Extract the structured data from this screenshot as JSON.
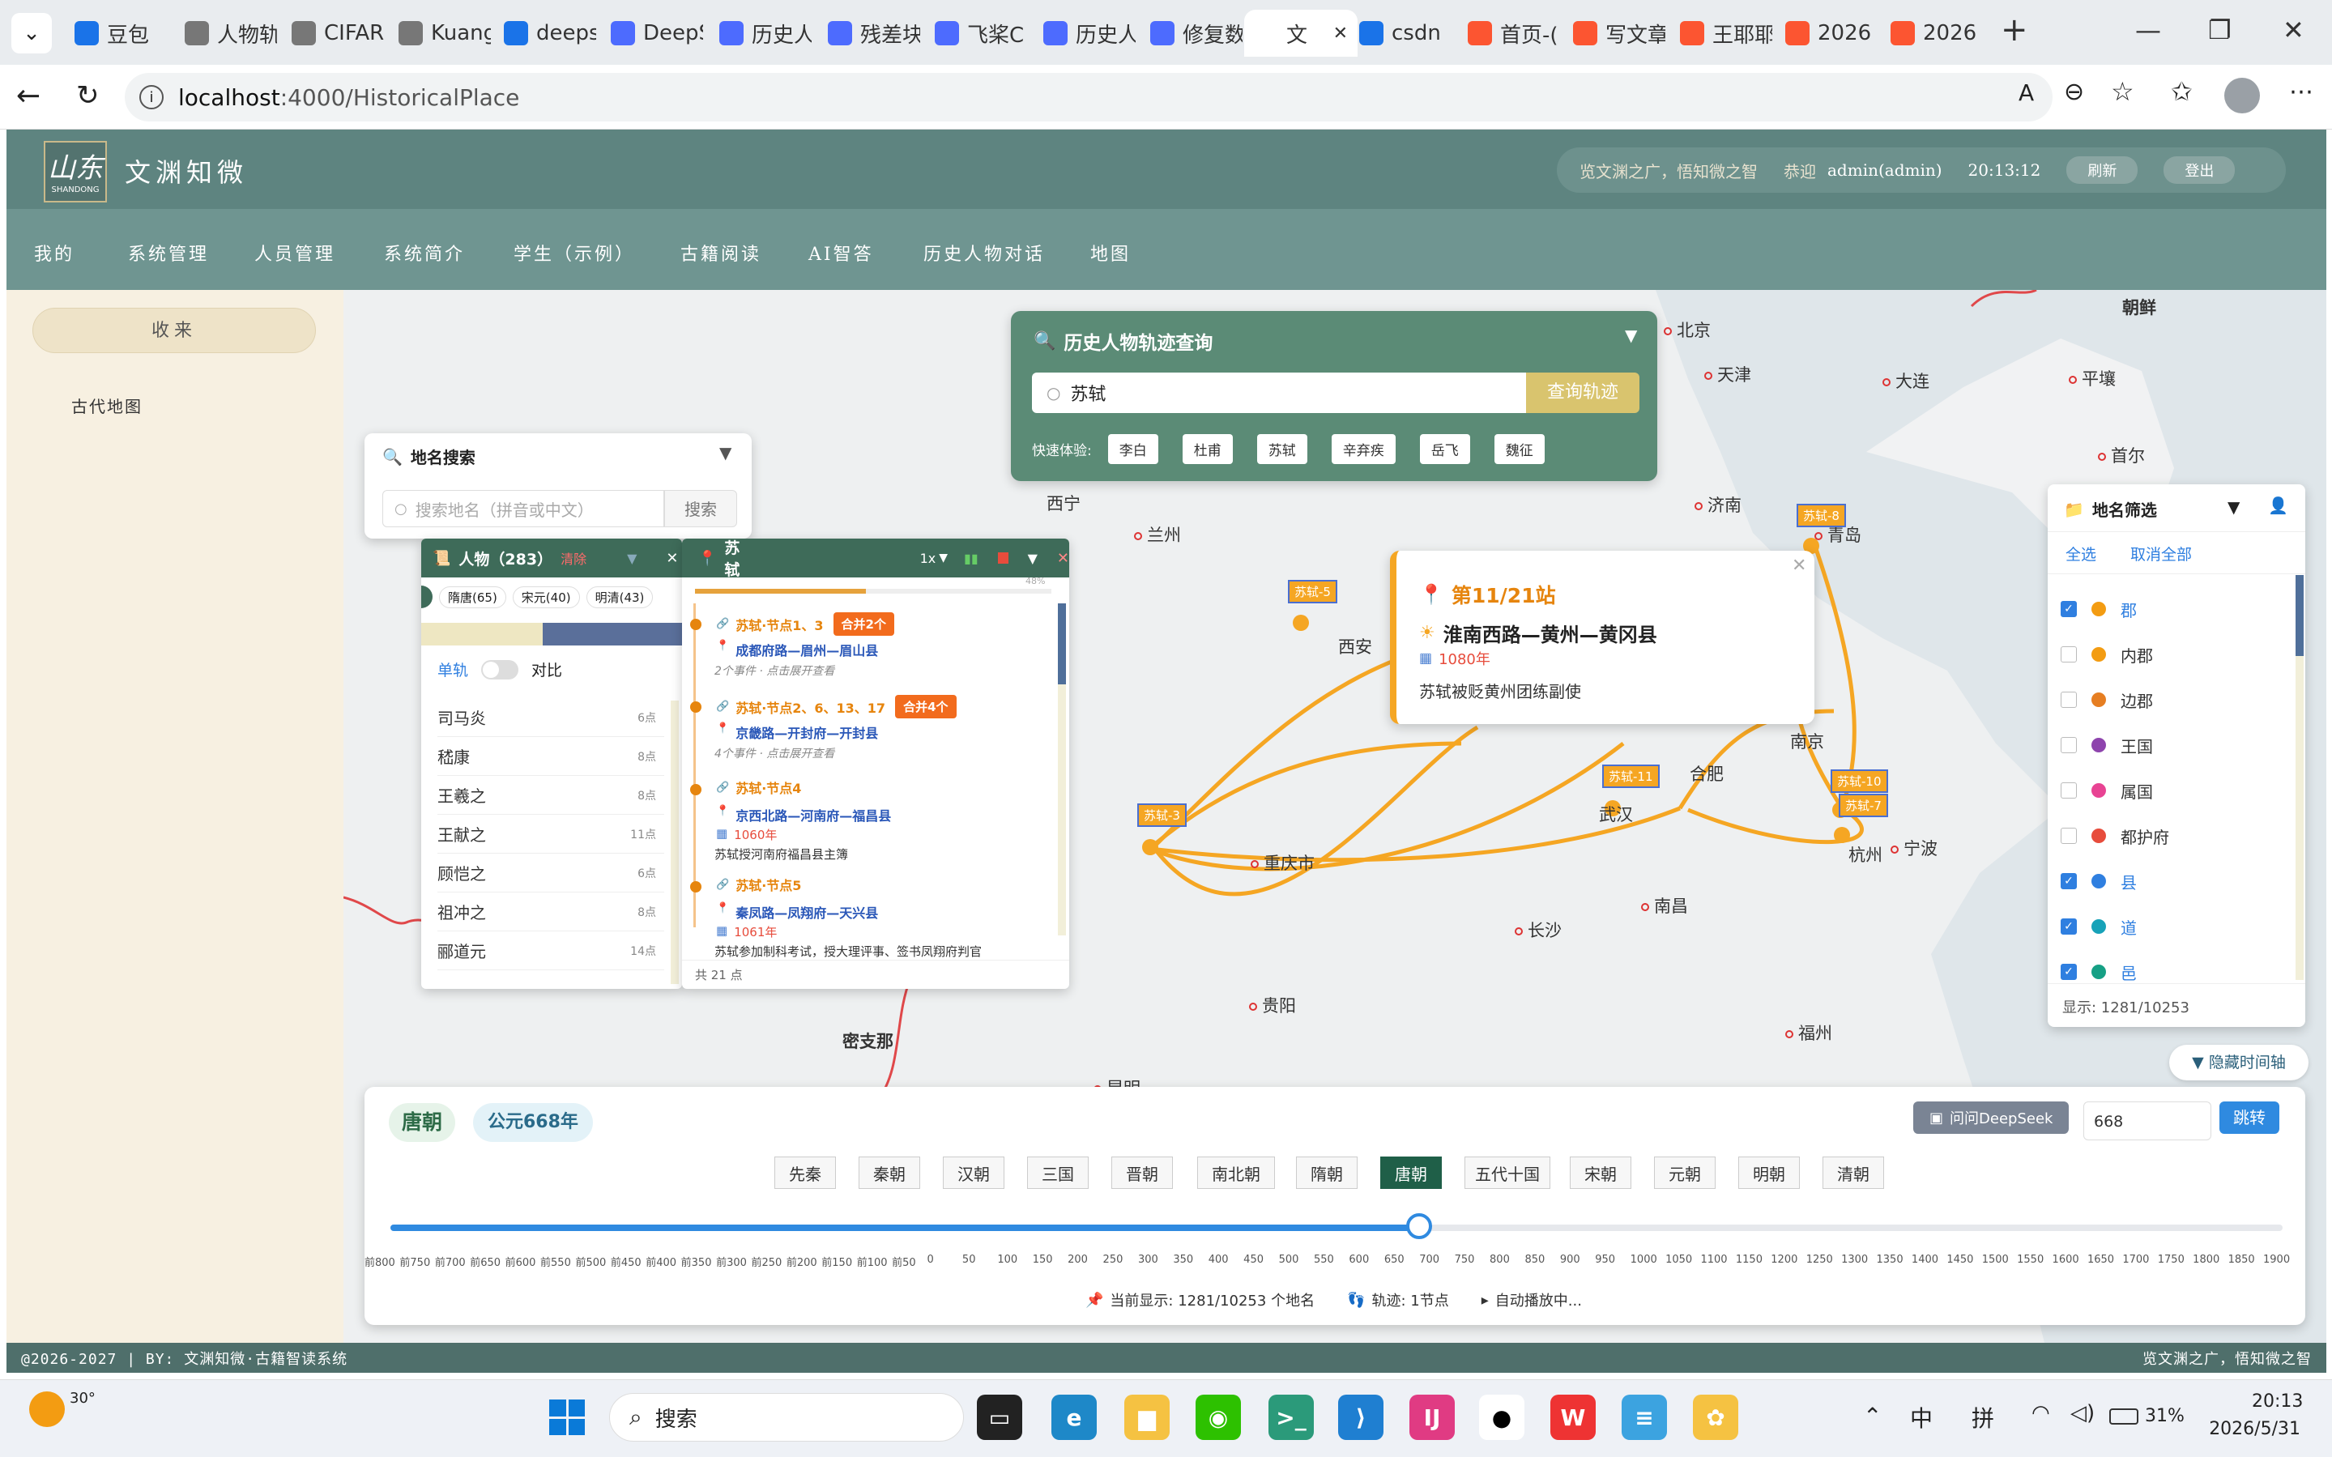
{
  "browser": {
    "tabs": [
      {
        "label": "豆包",
        "icon_color": "#1a73e8"
      },
      {
        "label": "人物轨",
        "icon_color": "#777"
      },
      {
        "label": "CIFAR",
        "icon_color": "#777"
      },
      {
        "label": "Kuang",
        "icon_color": "#777"
      },
      {
        "label": "deeps",
        "icon_color": "#1a73e8"
      },
      {
        "label": "DeepS",
        "icon_color": "#4d6bfe"
      },
      {
        "label": "历史人",
        "icon_color": "#4d6bfe"
      },
      {
        "label": "残差块",
        "icon_color": "#4d6bfe"
      },
      {
        "label": "飞桨C",
        "icon_color": "#4d6bfe"
      },
      {
        "label": "历史人",
        "icon_color": "#4d6bfe"
      },
      {
        "label": "修复数",
        "icon_color": "#4d6bfe"
      },
      {
        "label": "文",
        "icon_color": "#ffffff",
        "active": true
      },
      {
        "label": "csdn",
        "icon_color": "#1a73e8"
      },
      {
        "label": "首页-(",
        "icon_color": "#fc5531"
      },
      {
        "label": "写文章",
        "icon_color": "#fc5531"
      },
      {
        "label": "王耶耶",
        "icon_color": "#fc5531"
      },
      {
        "label": "2026",
        "icon_color": "#fc5531"
      },
      {
        "label": "2026",
        "icon_color": "#fc5531"
      }
    ],
    "url_host": "localhost",
    "url_path": ":4000/HistoricalPlace"
  },
  "header": {
    "logo_text": "山东",
    "logo_sub": "SHANDONG",
    "site_title": "文渊知微",
    "slogan": "览文渊之广，悟知微之智",
    "greet": "恭迎",
    "user": "admin(admin)",
    "time": "20:13:12",
    "refresh_btn": "刷新",
    "logout_btn": "登出"
  },
  "nav": [
    "我的",
    "系统管理",
    "人员管理",
    "系统简介",
    "学生（示例）",
    "古籍阅读",
    "AI智答",
    "历史人物对话",
    "地图"
  ],
  "sidebar": {
    "collect_btn": "收来",
    "item": "古代地图"
  },
  "track_query": {
    "title": "历史人物轨迹查询",
    "input_value": "苏轼",
    "submit": "查询轨迹",
    "quick_label": "快速体验:",
    "quick": [
      "李白",
      "杜甫",
      "苏轼",
      "辛弃疾",
      "岳飞",
      "魏征"
    ]
  },
  "place_search": {
    "title": "地名搜索",
    "placeholder": "搜索地名（拼音或中文）",
    "btn": "搜索"
  },
  "person_panel": {
    "title": "人物（283）",
    "clear": "清除",
    "dynasties": [
      "隋唐(65)",
      "宋元(40)",
      "明清(43)"
    ],
    "mode_single": "单轨",
    "mode_compare": "对比",
    "people": [
      {
        "name": "司马炎",
        "count": "6点"
      },
      {
        "name": "嵇康",
        "count": "8点"
      },
      {
        "name": "王羲之",
        "count": "8点"
      },
      {
        "name": "王献之",
        "count": "11点"
      },
      {
        "name": "顾恺之",
        "count": "6点"
      },
      {
        "name": "祖冲之",
        "count": "8点"
      },
      {
        "name": "郦道元",
        "count": "14点"
      }
    ]
  },
  "track_panel": {
    "title": "苏轼",
    "speed": "1x",
    "progress_pct": "48%",
    "total": "共 21 点",
    "nodes": [
      {
        "label": "苏轼·节点1、3",
        "badge": "合并2个",
        "place": "成都府路—眉州—眉山县",
        "note": "2个事件 · 点击展开查看"
      },
      {
        "label": "苏轼·节点2、6、13、17",
        "badge": "合并4个",
        "place": "京畿路—开封府—开封县",
        "note": "4个事件 · 点击展开查看"
      },
      {
        "label": "苏轼·节点4",
        "place": "京西北路—河南府—福昌县",
        "year": "1060年",
        "desc": "苏轼授河南府福昌县主簿"
      },
      {
        "label": "苏轼·节点5",
        "place": "秦凤路—凤翔府—天兴县",
        "year": "1061年",
        "desc": "苏轼参加制科考试，授大理评事、签书凤翔府判官"
      }
    ]
  },
  "station_popup": {
    "station": "第11/21站",
    "place": "淮南西路—黄州—黄冈县",
    "year": "1080年",
    "desc": "苏轼被贬黄州团练副使"
  },
  "map_labels": {
    "cities": [
      "北京",
      "天津",
      "大连",
      "平壤",
      "首尔",
      "朝鲜",
      "济南",
      "青岛",
      "兰州",
      "西宁",
      "西安",
      "合肥",
      "南京",
      "武汉",
      "杭州",
      "宁波",
      "重庆市",
      "长沙",
      "南昌",
      "贵阳",
      "福州",
      "密支那",
      "昆明"
    ],
    "markers": [
      "苏轼-8",
      "苏轼-5",
      "苏轼-3",
      "苏轼-11",
      "苏轼-10",
      "苏轼-7"
    ]
  },
  "filter_panel": {
    "title": "地名筛选",
    "select_all": "全选",
    "deselect_all": "取消全部",
    "items": [
      {
        "label": "郡",
        "color": "#f39c12",
        "checked": true
      },
      {
        "label": "内郡",
        "color": "#f39c12",
        "checked": false
      },
      {
        "label": "边郡",
        "color": "#e67e22",
        "checked": false
      },
      {
        "label": "王国",
        "color": "#8e44ad",
        "checked": false
      },
      {
        "label": "属国",
        "color": "#e84393",
        "checked": false
      },
      {
        "label": "都护府",
        "color": "#e74c3c",
        "checked": false
      },
      {
        "label": "县",
        "color": "#2f7fe0",
        "checked": true
      },
      {
        "label": "道",
        "color": "#17a2b8",
        "checked": true
      },
      {
        "label": "邑",
        "color": "#16a085",
        "checked": true
      }
    ],
    "count": "显示: 1281/10253",
    "hide_timeline": "▼ 隐藏时间轴"
  },
  "timeline": {
    "dynasty": "唐朝",
    "year": "公元668年",
    "ask_btn": "问问DeepSeek",
    "year_input": "668",
    "jump_btn": "跳转",
    "dynasty_buttons": [
      "先秦",
      "秦朝",
      "汉朝",
      "三国",
      "晋朝",
      "南北朝",
      "隋朝",
      "唐朝",
      "五代十国",
      "宋朝",
      "元朝",
      "明朝",
      "清朝"
    ],
    "active_dynasty": "唐朝",
    "slider_value": 668,
    "slider_min": -800,
    "slider_max": 1900,
    "ticks": [
      "前800",
      "前750",
      "前700",
      "前650",
      "前600",
      "前550",
      "前500",
      "前450",
      "前400",
      "前350",
      "前300",
      "前250",
      "前200",
      "前150",
      "前100",
      "前50",
      "0",
      "50",
      "100",
      "150",
      "200",
      "250",
      "300",
      "350",
      "400",
      "450",
      "500",
      "550",
      "600",
      "650",
      "700",
      "750",
      "800",
      "850",
      "900",
      "950",
      "1000",
      "1050",
      "1100",
      "1150",
      "1200",
      "1250",
      "1300",
      "1350",
      "1400",
      "1450",
      "1500",
      "1550",
      "1600",
      "1650",
      "1700",
      "1750",
      "1800",
      "1850",
      "1900"
    ],
    "status_places": "当前显示: 1281/10253 个地名",
    "status_track": "轨迹: 1节点",
    "status_play": "自动播放中..."
  },
  "footer": {
    "left": "@2026-2027 | BY: 文渊知微·古籍智读系统",
    "right": "览文渊之广，悟知微之智"
  },
  "taskbar": {
    "weather": "30°",
    "search": "搜索",
    "time": "20:13",
    "date": "2026/5/31",
    "ime1": "中",
    "ime2": "拼",
    "battery": "31%"
  }
}
